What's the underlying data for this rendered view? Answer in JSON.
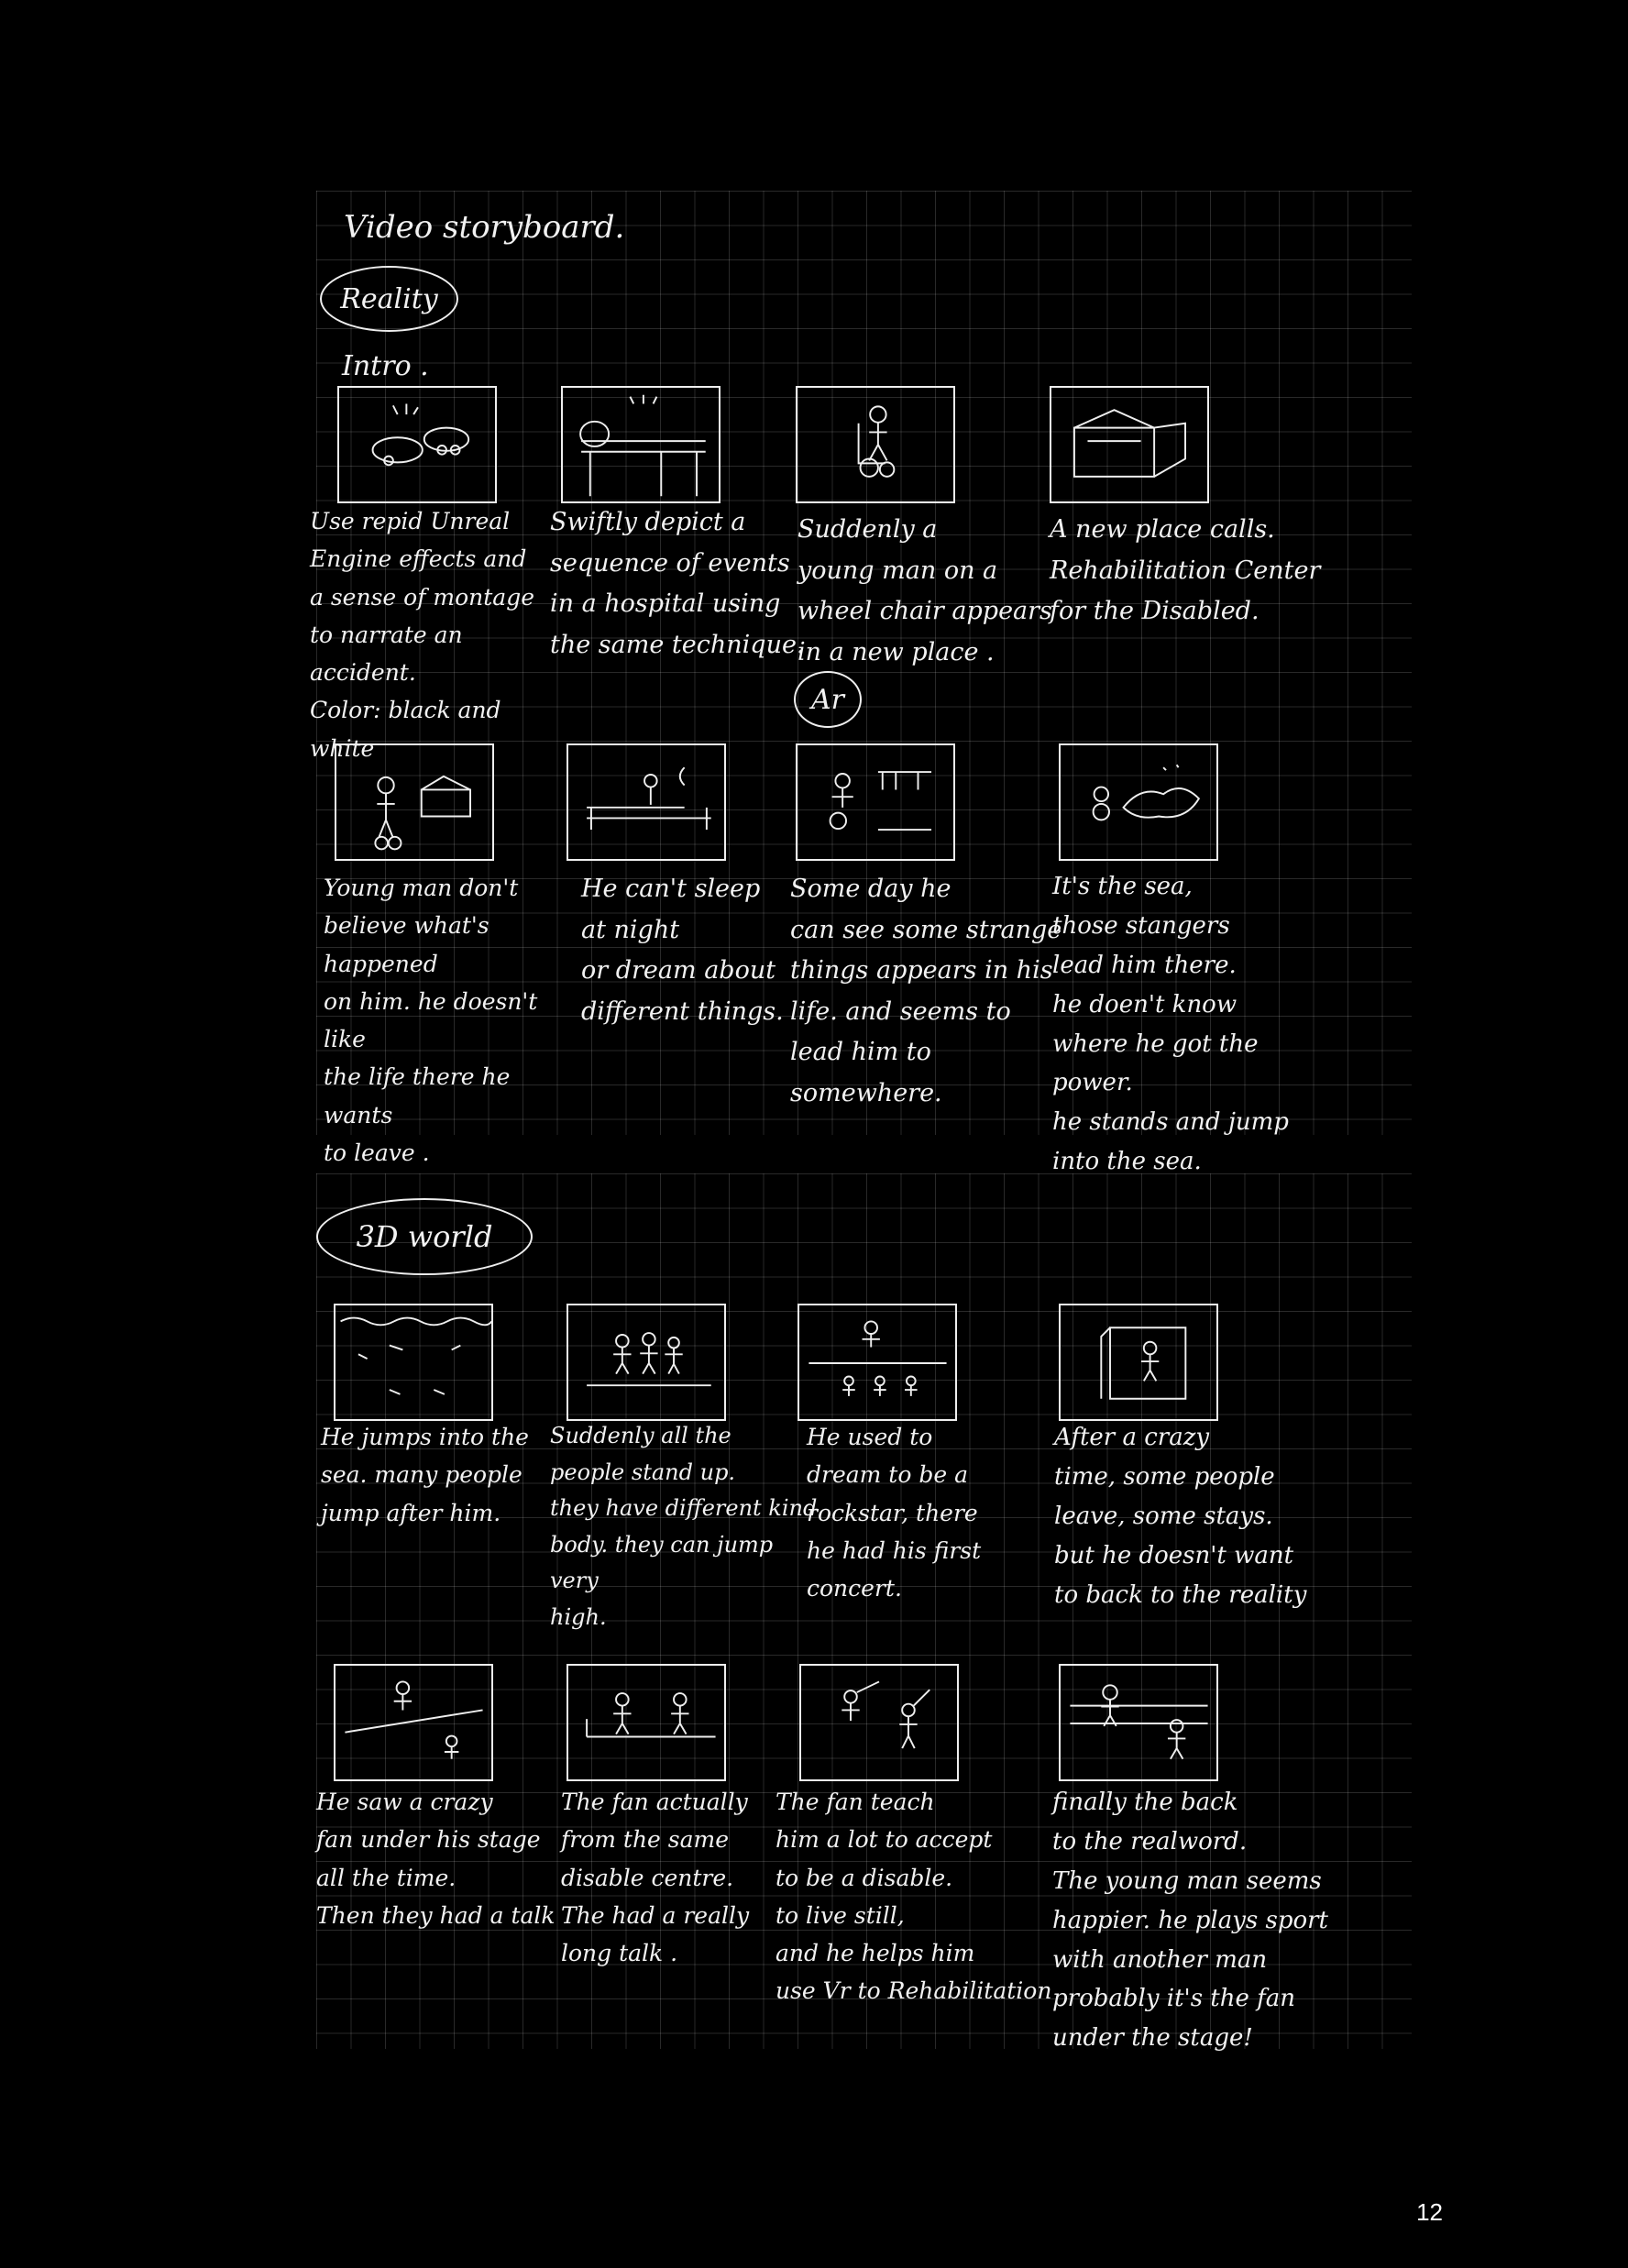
{
  "header": {
    "title": "Video storyboard."
  },
  "sections": {
    "reality": {
      "label": "Reality",
      "intro": "Intro ."
    },
    "ar": {
      "label": "Ar"
    },
    "world3d": {
      "label": "3D world"
    }
  },
  "panels": [
    {
      "sketch": "car-crash-sketch",
      "caption": "Use repid Unreal\nEngine effects and\na sense of montage\nto narrate an accident.\nColor: black and white"
    },
    {
      "sketch": "hospital-bed-sketch",
      "caption": "Swiftly depict a\nsequence of events\nin a hospital using\nthe same technique."
    },
    {
      "sketch": "wheelchair-man-sketch",
      "caption": "Suddenly a\nyoung man on a\nwheel chair appears\nin a new place ."
    },
    {
      "sketch": "building-sketch",
      "caption": "A new place calls.\nRehabilitation Center\nfor the Disabled."
    },
    {
      "sketch": "man-leaving-sketch",
      "caption": "Young man don't\nbelieve what's happened\non him. he doesn't like\nthe life there he wants\nto leave ."
    },
    {
      "sketch": "bed-at-night-sketch",
      "caption": "He can't sleep\nat night\nor dream about\ndifferent things."
    },
    {
      "sketch": "strange-things-sketch",
      "caption": "Some day he\ncan see some strange\nthings appears in his\nlife. and seems to\nlead him to somewhere."
    },
    {
      "sketch": "sea-sketch",
      "caption": "It's the sea,\nthose stangers\nlead him there.\nhe doen't know\nwhere he got the power.\nhe stands and jump\ninto the sea."
    },
    {
      "sketch": "underwater-sketch",
      "caption": "He jumps into the\nsea. many people\njump after him."
    },
    {
      "sketch": "three-figures-sketch",
      "caption": "Suddenly all the\npeople stand up.\nthey have different kind\nbody. they can jump very\nhigh."
    },
    {
      "sketch": "concert-sketch",
      "caption": "He used to\ndream to be a\nrockstar, there\nhe had his first concert."
    },
    {
      "sketch": "window-figure-sketch",
      "caption": "After a crazy\ntime, some people\nleave, some stays.\nbut he doesn't want\nto back to the reality"
    },
    {
      "sketch": "stage-fan-sketch",
      "caption": "He saw a crazy\nfan under his stage\nall the time.\nThen they had a talk"
    },
    {
      "sketch": "two-figures-sketch",
      "caption": "The fan actually\nfrom the same\ndisable centre.\nThe had a really\nlong talk ."
    },
    {
      "sketch": "teaching-sketch",
      "caption": "The fan teach\nhim a lot to accept\nto be a disable.\nto live still,\nand he helps him\nuse Vr to Rehabilitation"
    },
    {
      "sketch": "sport-sketch",
      "caption": "finally the back\nto the realword.\nThe young man seems\nhappier. he plays sport\nwith another man\nprobably it's the fan\nunder the stage!"
    }
  ],
  "page_number": "12"
}
